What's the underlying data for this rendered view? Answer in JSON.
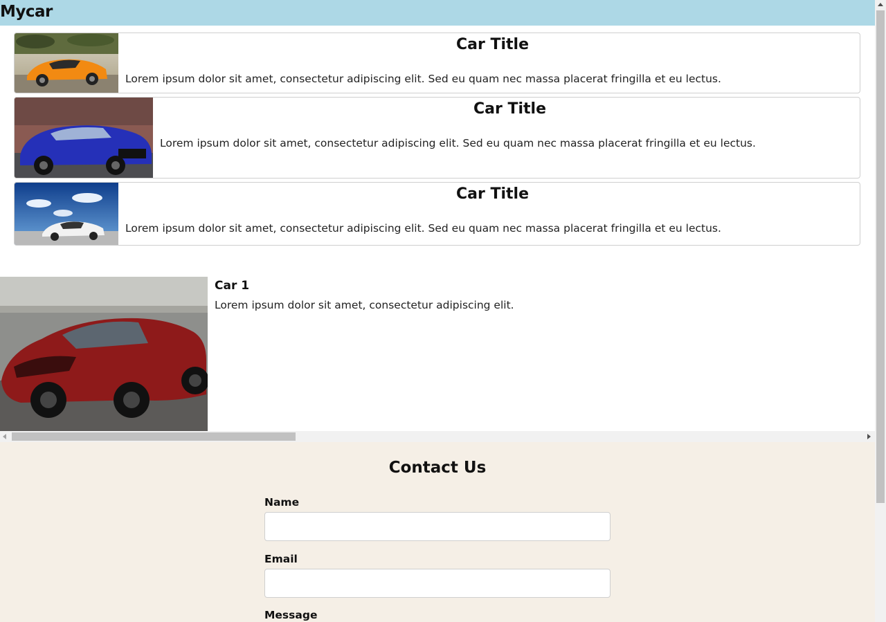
{
  "header": {
    "brand": "Mycar",
    "background": "#add8e6"
  },
  "cards": [
    {
      "title": "Car Title",
      "text": "Lorem ipsum dolor sit amet, consectetur adipiscing elit. Sed eu quam nec massa placerat fringilla et eu lectus.",
      "image": "orange-sports-car"
    },
    {
      "title": "Car Title",
      "text": "Lorem ipsum dolor sit amet, consectetur adipiscing elit. Sed eu quam nec massa placerat fringilla et eu lectus.",
      "image": "blue-sedan"
    },
    {
      "title": "Car Title",
      "text": "Lorem ipsum dolor sit amet, consectetur adipiscing elit. Sed eu quam nec massa placerat fringilla et eu lectus.",
      "image": "white-sports-car"
    }
  ],
  "gallery": {
    "items": [
      {
        "title": "Car 1",
        "text": "Lorem ipsum dolor sit amet, consectetur adipiscing elit.",
        "image": "red-supercar"
      }
    ]
  },
  "contact": {
    "title": "Contact Us",
    "background": "#f5efe6",
    "fields": [
      {
        "label": "Name",
        "value": "",
        "placeholder": ""
      },
      {
        "label": "Email",
        "value": "",
        "placeholder": ""
      },
      {
        "label": "Message",
        "value": "",
        "placeholder": ""
      }
    ]
  }
}
